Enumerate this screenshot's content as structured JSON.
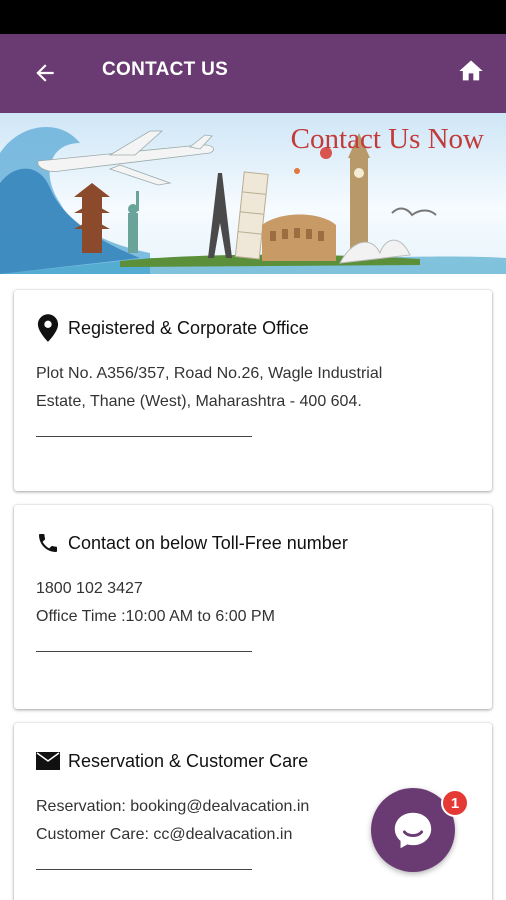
{
  "app_bar": {
    "title": "CONTACT US",
    "back_icon": "arrow-left-icon",
    "home_icon": "home-icon",
    "color": "#6a3b73"
  },
  "banner": {
    "title": "Contact Us Now"
  },
  "cards": [
    {
      "icon": "location-pin-icon",
      "title": "Registered & Corporate Office",
      "lines": [
        "Plot No. A356/357, Road No.26, Wagle Industrial",
        "Estate, Thane (West), Maharashtra - 400 604."
      ]
    },
    {
      "icon": "phone-icon",
      "title": "Contact on below Toll-Free number",
      "lines": [
        "1800 102 3427",
        "Office Time :10:00 AM to 6:00 PM"
      ]
    },
    {
      "icon": "envelope-icon",
      "title": "Reservation & Customer Care",
      "lines": [
        "Reservation: booking@dealvacation.in",
        "Customer Care: cc@dealvacation.in"
      ]
    }
  ],
  "chat": {
    "icon": "chat-bubble-icon",
    "badge": "1",
    "badge_color": "#e53935"
  }
}
